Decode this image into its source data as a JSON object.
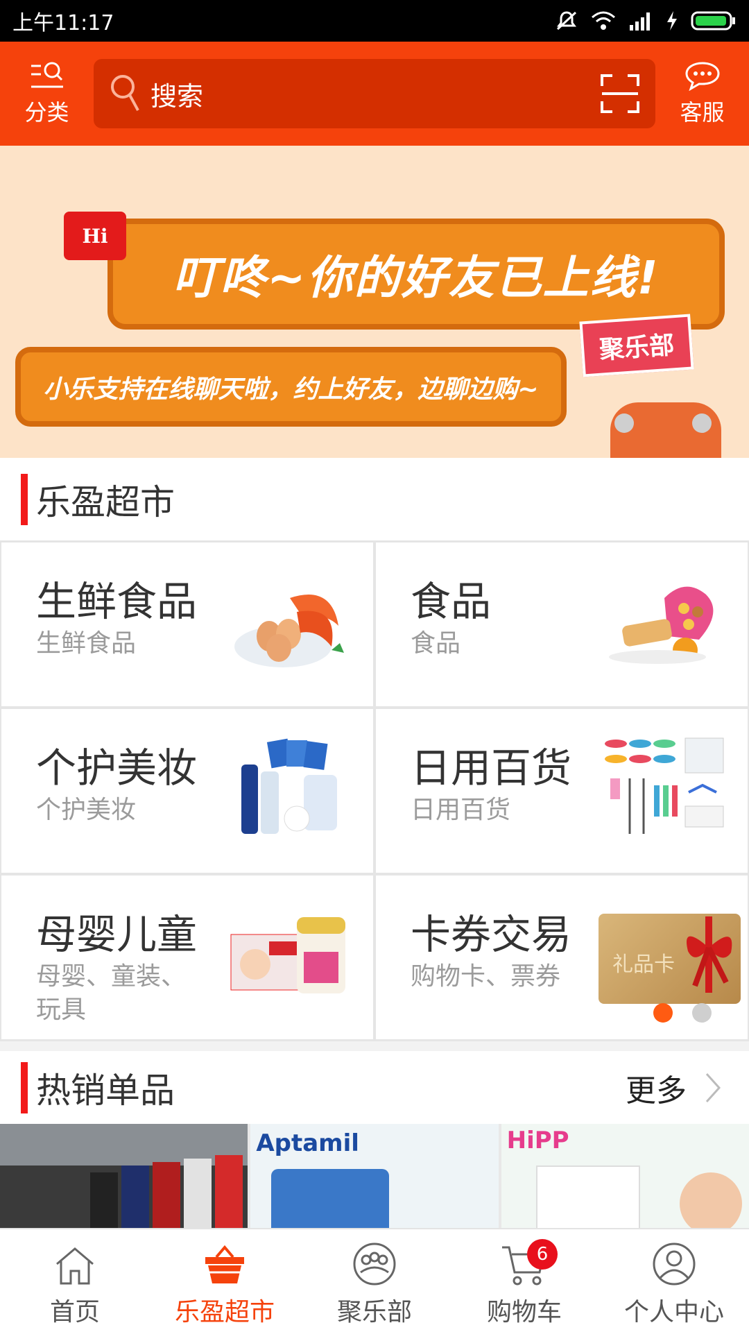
{
  "status_bar": {
    "time": "上午11:17"
  },
  "header": {
    "category_label": "分类",
    "search_placeholder": "搜索",
    "service_label": "客服"
  },
  "banner": {
    "hi_badge": "Hi",
    "headline": "叮咚~你的好友已上线!",
    "subline": "小乐支持在线聊天啦，约上好友，边聊边购~",
    "tag": "聚乐部"
  },
  "supermarket": {
    "title": "乐盈超市",
    "categories": [
      {
        "title": "生鲜食品",
        "subtitle": "生鲜食品",
        "icon": "seafood-eggs-image"
      },
      {
        "title": "食品",
        "subtitle": "食品",
        "icon": "snacks-image"
      },
      {
        "title": "个护美妆",
        "subtitle": "个护美妆",
        "icon": "personal-care-image"
      },
      {
        "title": "日用百货",
        "subtitle": "日用百货",
        "icon": "household-goods-image"
      },
      {
        "title": "母婴儿童",
        "subtitle": "母婴、童装、玩具",
        "icon": "baby-products-image"
      },
      {
        "title": "卡券交易",
        "subtitle": "购物卡、票券",
        "icon": "gift-card-image"
      }
    ],
    "gift_card_text": "礼品卡"
  },
  "hot_items": {
    "title": "热销单品",
    "more_label": "更多",
    "products": [
      {
        "brand": ""
      },
      {
        "brand": "Aptamil"
      },
      {
        "brand": "HiPP"
      }
    ]
  },
  "bottom_nav": {
    "items": [
      {
        "label": "首页",
        "icon": "home-icon"
      },
      {
        "label": "乐盈超市",
        "icon": "basket-icon",
        "active": true
      },
      {
        "label": "聚乐部",
        "icon": "club-icon"
      },
      {
        "label": "购物车",
        "icon": "cart-icon",
        "badge": "6"
      },
      {
        "label": "个人中心",
        "icon": "user-icon"
      }
    ]
  },
  "colors": {
    "brand": "#f5420c",
    "accent_red": "#f21a1a"
  }
}
